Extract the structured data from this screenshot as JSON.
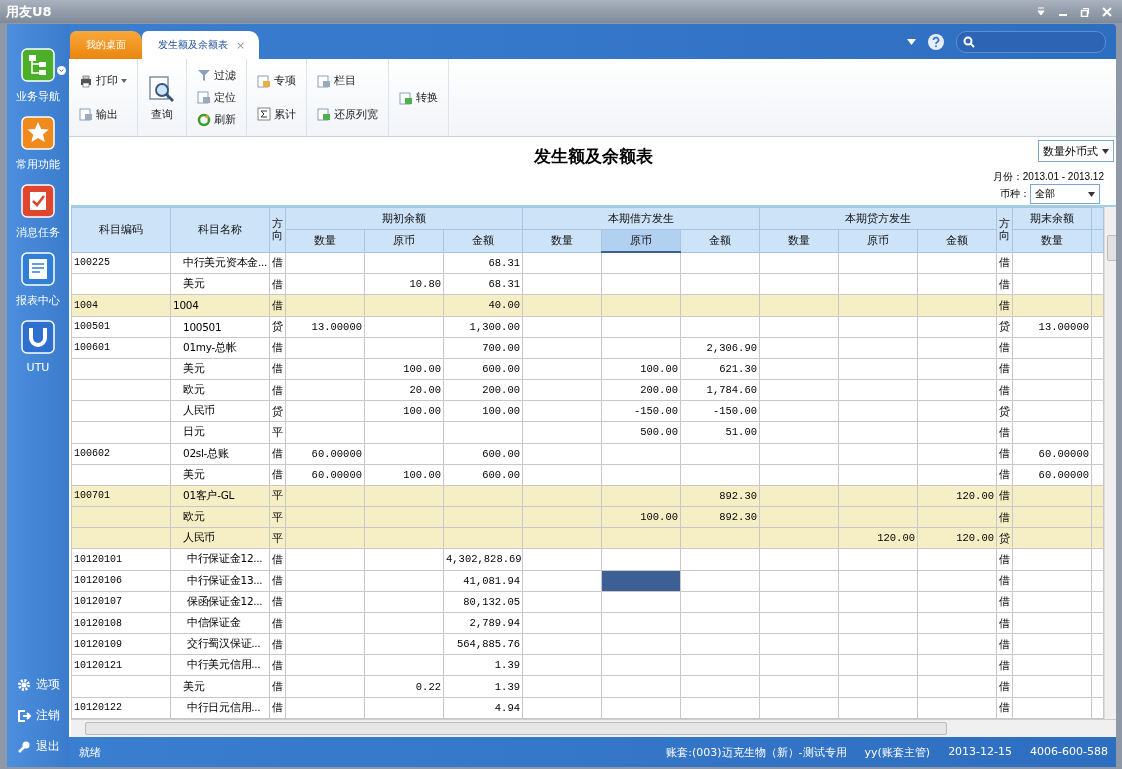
{
  "window": {
    "title": "用友U8"
  },
  "sidebar": {
    "items": [
      {
        "label": "业务导航",
        "kind": "nav"
      },
      {
        "label": "常用功能",
        "kind": "star"
      },
      {
        "label": "消息任务",
        "kind": "task"
      },
      {
        "label": "报表中心",
        "kind": "report"
      },
      {
        "label": "UTU",
        "kind": "utu"
      }
    ],
    "bottom": [
      {
        "label": "选项",
        "kind": "gear"
      },
      {
        "label": "注销",
        "kind": "logout"
      },
      {
        "label": "退出",
        "kind": "key"
      }
    ]
  },
  "tabs": [
    {
      "label": "我的桌面",
      "selected": false
    },
    {
      "label": "发生额及余额表",
      "selected": true,
      "close": "×"
    }
  ],
  "toolbar": {
    "groups": [
      [
        {
          "label": "打印",
          "kind": "print",
          "dropdown": true
        },
        {
          "label": "输出",
          "kind": "export",
          "dropdown": false
        }
      ],
      [
        {
          "label": "查询",
          "kind": "query",
          "dropdown": false
        }
      ],
      [
        {
          "label": "过滤",
          "kind": "filter",
          "dropdown": false
        },
        {
          "label": "定位",
          "kind": "locate",
          "dropdown": false
        },
        {
          "label": "刷新",
          "kind": "refresh",
          "dropdown": false
        }
      ],
      [
        {
          "label": "专项",
          "kind": "special",
          "dropdown": false
        },
        {
          "label": "累计",
          "kind": "sum",
          "dropdown": false
        }
      ],
      [
        {
          "label": "栏目",
          "kind": "columns",
          "dropdown": false
        },
        {
          "label": "还原列宽",
          "kind": "reset",
          "dropdown": false
        }
      ],
      [
        {
          "label": "转换",
          "kind": "convert",
          "dropdown": false
        }
      ]
    ]
  },
  "report": {
    "title": "发生额及余额表",
    "format": "数量外币式",
    "month_label": "月份：",
    "month_value": "2013.01 - 2013.12",
    "currency_label": "币种：",
    "currency_value": "全部"
  },
  "table": {
    "columns": [
      {
        "label": "科目编码"
      },
      {
        "label": "科目名称"
      },
      {
        "label": "方向"
      }
    ],
    "groups": [
      {
        "label": "期初余额",
        "subs": [
          {
            "label": "数量",
            "focused": false
          },
          {
            "label": "原币",
            "focused": false
          },
          {
            "label": "金额",
            "focused": false
          }
        ]
      },
      {
        "label": "本期借方发生",
        "subs": [
          {
            "label": "数量",
            "focused": false
          },
          {
            "label": "原币",
            "focused": true
          },
          {
            "label": "金额",
            "focused": false
          }
        ]
      },
      {
        "label": "本期贷方发生",
        "subs": [
          {
            "label": "数量",
            "focused": false
          },
          {
            "label": "原币",
            "focused": false
          },
          {
            "label": "金额",
            "focused": false
          }
        ]
      }
    ],
    "end_direction": "方向",
    "end_group": {
      "label": "期末余额",
      "sub": "数量"
    },
    "rows": [
      {
        "code": "100225",
        "name": "中行美元资本金...",
        "kind": "sub",
        "dir": "借",
        "opening": {
          "amount": "68.31"
        },
        "end_dir": "借",
        "highlight": false,
        "selected": false
      },
      {
        "name": "美元",
        "kind": "sub",
        "dir": "借",
        "opening": {
          "original": "10.80",
          "amount": "68.31"
        },
        "end_dir": "借",
        "highlight": false,
        "selected": false
      },
      {
        "code": "1004",
        "name": "1004",
        "kind": "top",
        "dir": "借",
        "opening": {
          "amount": "40.00"
        },
        "end_dir": "借",
        "highlight": true,
        "selected": false
      },
      {
        "code": "100501",
        "name": "100501",
        "kind": "sub",
        "dir": "贷",
        "opening": {
          "quantity": "13.00000",
          "amount": "1,300.00"
        },
        "end_dir": "贷",
        "end_qty": "13.00000",
        "highlight": false,
        "selected": false
      },
      {
        "code": "100601",
        "name": "01my-总帐",
        "kind": "sub",
        "dir": "借",
        "opening": {
          "amount": "700.00"
        },
        "debit": {
          "amount": "2,306.90"
        },
        "end_dir": "借",
        "highlight": false,
        "selected": false
      },
      {
        "name": "美元",
        "kind": "sub",
        "dir": "借",
        "opening": {
          "original": "100.00",
          "amount": "600.00"
        },
        "debit": {
          "original": "100.00",
          "amount": "621.30"
        },
        "end_dir": "借",
        "highlight": false,
        "selected": false
      },
      {
        "name": "欧元",
        "kind": "sub",
        "dir": "借",
        "opening": {
          "original": "20.00",
          "amount": "200.00"
        },
        "debit": {
          "original": "200.00",
          "amount": "1,784.60"
        },
        "end_dir": "借",
        "highlight": false,
        "selected": false
      },
      {
        "name": "人民币",
        "kind": "sub",
        "dir": "贷",
        "opening": {
          "original": "100.00",
          "amount": "100.00"
        },
        "debit": {
          "original": "-150.00",
          "amount": "-150.00"
        },
        "end_dir": "贷",
        "highlight": false,
        "selected": false
      },
      {
        "name": "日元",
        "kind": "sub",
        "dir": "平",
        "debit": {
          "original": "500.00",
          "amount": "51.00"
        },
        "end_dir": "借",
        "highlight": false,
        "selected": false
      },
      {
        "code": "100602",
        "name": "02sl-总账",
        "kind": "sub",
        "dir": "借",
        "opening": {
          "quantity": "60.00000",
          "amount": "600.00"
        },
        "end_dir": "借",
        "end_qty": "60.00000",
        "highlight": false,
        "selected": false
      },
      {
        "name": "美元",
        "kind": "sub",
        "dir": "借",
        "opening": {
          "quantity": "60.00000",
          "original": "100.00",
          "amount": "600.00"
        },
        "end_dir": "借",
        "end_qty": "60.00000",
        "highlight": false,
        "selected": false
      },
      {
        "code": "100701",
        "name": "01客户-GL",
        "kind": "sub",
        "dir": "平",
        "debit": {
          "amount": "892.30"
        },
        "credit": {
          "amount": "120.00"
        },
        "end_dir": "借",
        "highlight": true,
        "selected": false
      },
      {
        "name": "欧元",
        "kind": "sub",
        "dir": "平",
        "debit": {
          "original": "100.00",
          "amount": "892.30"
        },
        "end_dir": "借",
        "highlight": true,
        "selected": false
      },
      {
        "name": "人民币",
        "kind": "sub",
        "dir": "平",
        "credit": {
          "original": "120.00",
          "amount": "120.00"
        },
        "end_dir": "贷",
        "highlight": true,
        "selected": false
      },
      {
        "code": "10120101",
        "name": "中行保证金12...",
        "kind": "deep",
        "dir": "借",
        "opening": {
          "amount": "4,302,828.69"
        },
        "end_dir": "借",
        "highlight": false,
        "selected": false
      },
      {
        "code": "10120106",
        "name": "中行保证金13...",
        "kind": "deep",
        "dir": "借",
        "opening": {
          "amount": "41,081.94"
        },
        "end_dir": "借",
        "highlight": false,
        "selected": true
      },
      {
        "code": "10120107",
        "name": "保函保证金12...",
        "kind": "deep",
        "dir": "借",
        "opening": {
          "amount": "80,132.05"
        },
        "end_dir": "借",
        "highlight": false,
        "selected": false
      },
      {
        "code": "10120108",
        "name": "中信保证金",
        "kind": "deep",
        "dir": "借",
        "opening": {
          "amount": "2,789.94"
        },
        "end_dir": "借",
        "highlight": false,
        "selected": false
      },
      {
        "code": "10120109",
        "name": "交行蜀汉保证...",
        "kind": "deep",
        "dir": "借",
        "opening": {
          "amount": "564,885.76"
        },
        "end_dir": "借",
        "highlight": false,
        "selected": false
      },
      {
        "code": "10120121",
        "name": "中行美元信用...",
        "kind": "deep",
        "dir": "借",
        "opening": {
          "amount": "1.39"
        },
        "end_dir": "借",
        "highlight": false,
        "selected": false
      },
      {
        "name": "美元",
        "kind": "sub",
        "dir": "借",
        "opening": {
          "original": "0.22",
          "amount": "1.39"
        },
        "end_dir": "借",
        "highlight": false,
        "selected": false
      },
      {
        "code": "10120122",
        "name": "中行日元信用...",
        "kind": "deep",
        "dir": "借",
        "opening": {
          "amount": "4.94"
        },
        "end_dir": "借",
        "highlight": false,
        "selected": false
      }
    ]
  },
  "status_bar": {
    "state": "就绪",
    "account": "账套:(003)迈克生物（新）-测试专用",
    "user": "yy(账套主管)",
    "date": "2013-12-15",
    "phone": "4006-600-588"
  }
}
